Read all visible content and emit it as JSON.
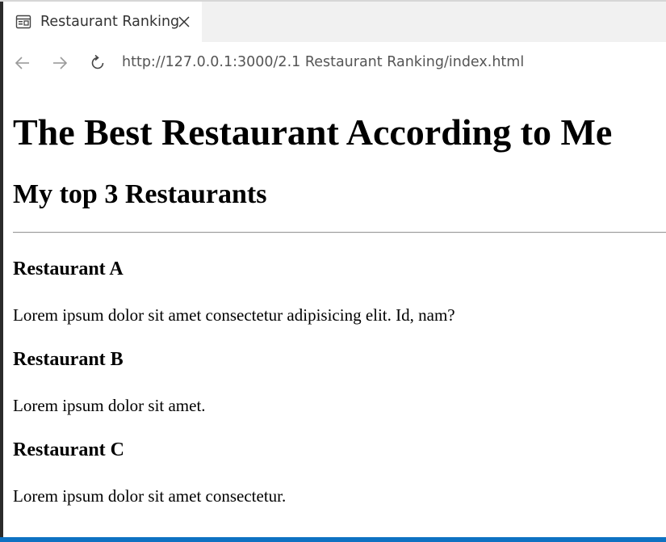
{
  "browser": {
    "tab": {
      "title": "Restaurant Ranking",
      "icon": "page-icon",
      "close_icon": "close-icon"
    },
    "nav": {
      "back_icon": "arrow-left-icon",
      "forward_icon": "arrow-right-icon",
      "reload_icon": "reload-icon",
      "url": "http://127.0.0.1:3000/2.1 Restaurant Ranking/index.html"
    }
  },
  "page": {
    "heading": "The Best Restaurant According to Me",
    "subheading": "My top 3 Restaurants",
    "restaurants": [
      {
        "name": "Restaurant A",
        "description": "Lorem ipsum dolor sit amet consectetur adipisicing elit. Id, nam?"
      },
      {
        "name": "Restaurant B",
        "description": "Lorem ipsum dolor sit amet."
      },
      {
        "name": "Restaurant C",
        "description": "Lorem ipsum dolor sit amet consectetur."
      }
    ]
  },
  "colors": {
    "statusbar": "#0e72c2",
    "window_edge": "#2b2b2b"
  }
}
